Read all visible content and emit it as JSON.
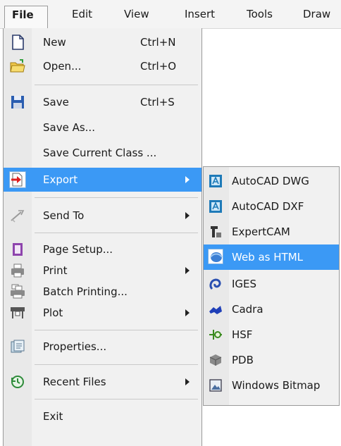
{
  "menubar": {
    "items": [
      {
        "label": "File",
        "active": true
      },
      {
        "label": "Edit"
      },
      {
        "label": "View"
      },
      {
        "label": "Insert"
      },
      {
        "label": "Tools"
      },
      {
        "label": "Draw"
      }
    ]
  },
  "file_menu": {
    "new": {
      "label": "New",
      "shortcut": "Ctrl+N",
      "icon": "new-document-icon"
    },
    "open": {
      "label": "Open...",
      "shortcut": "Ctrl+O",
      "icon": "open-folder-icon"
    },
    "save": {
      "label": "Save",
      "shortcut": "Ctrl+S",
      "icon": "floppy-disk-icon"
    },
    "save_as": {
      "label": "Save As..."
    },
    "save_current_class": {
      "label": "Save Current Class ..."
    },
    "export": {
      "label": "Export",
      "icon": "export-arrow-icon",
      "highlighted": true
    },
    "send_to": {
      "label": "Send To",
      "icon": "send-to-icon"
    },
    "page_setup": {
      "label": "Page Setup...",
      "icon": "page-setup-icon"
    },
    "print": {
      "label": "Print",
      "icon": "printer-icon"
    },
    "batch_printing": {
      "label": "Batch Printing...",
      "icon": "batch-print-icon"
    },
    "plot": {
      "label": "Plot",
      "icon": "plotter-icon"
    },
    "properties": {
      "label": "Properties...",
      "icon": "properties-icon"
    },
    "recent_files": {
      "label": "Recent Files",
      "icon": "recent-files-icon"
    },
    "exit": {
      "label": "Exit"
    }
  },
  "export_menu": {
    "items": [
      {
        "label": "AutoCAD DWG",
        "icon": "autocad-dwg-icon"
      },
      {
        "label": "AutoCAD DXF",
        "icon": "autocad-dxf-icon"
      },
      {
        "label": "ExpertCAM",
        "icon": "expertcam-icon"
      },
      {
        "label": "Web as HTML",
        "icon": "web-html-icon",
        "highlighted": true
      },
      {
        "label": "IGES",
        "icon": "iges-icon"
      },
      {
        "label": "Cadra",
        "icon": "cadra-icon"
      },
      {
        "label": "HSF",
        "icon": "hsf-icon"
      },
      {
        "label": "PDB",
        "icon": "pdb-icon"
      },
      {
        "label": "Windows Bitmap",
        "icon": "windows-bitmap-icon"
      }
    ]
  },
  "colors": {
    "highlight": "#3b99f5",
    "menu_bg": "#f1f1f1",
    "gutter_bg": "#e9e9e9"
  }
}
